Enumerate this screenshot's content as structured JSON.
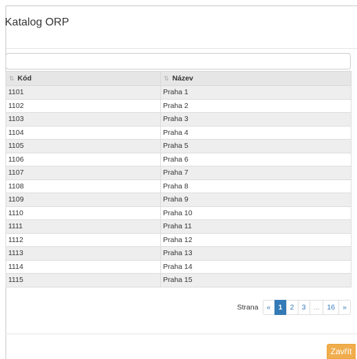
{
  "dialog": {
    "title": "Katalog ORP"
  },
  "filter": {
    "value": "",
    "placeholder": ""
  },
  "table": {
    "columns": [
      "Kód",
      "Název"
    ],
    "rows": [
      [
        "1101",
        "Praha 1"
      ],
      [
        "1102",
        "Praha 2"
      ],
      [
        "1103",
        "Praha 3"
      ],
      [
        "1104",
        "Praha 4"
      ],
      [
        "1105",
        "Praha 5"
      ],
      [
        "1106",
        "Praha 6"
      ],
      [
        "1107",
        "Praha 7"
      ],
      [
        "1108",
        "Praha 8"
      ],
      [
        "1109",
        "Praha 9"
      ],
      [
        "1110",
        "Praha 10"
      ],
      [
        "1111",
        "Praha 11"
      ],
      [
        "1112",
        "Praha 12"
      ],
      [
        "1113",
        "Praha 13"
      ],
      [
        "1114",
        "Praha 14"
      ],
      [
        "1115",
        "Praha 15"
      ]
    ]
  },
  "pagination": {
    "label": "Strana",
    "prev": "«",
    "pages": [
      "1",
      "2",
      "3"
    ],
    "ellipsis": "...",
    "last_page": "16",
    "next": "»",
    "current": "1"
  },
  "footer": {
    "close_label": "Zavřít"
  },
  "icons": {
    "sort": "sort-icon"
  },
  "colors": {
    "accent": "#337ab7",
    "close_button": "#f0ad4e",
    "row_stripe": "#eeeeee"
  }
}
